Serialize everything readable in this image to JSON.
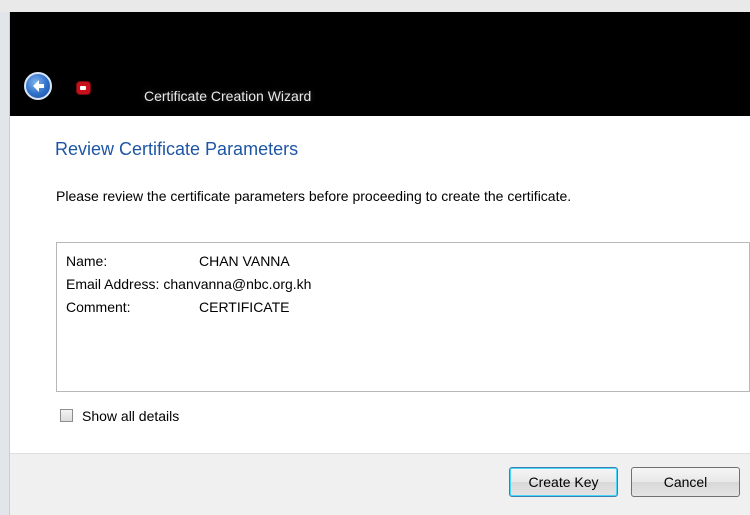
{
  "window": {
    "title": "Certificate Creation Wizard",
    "back_icon": "back-arrow-icon",
    "app_icon": "certificate-app-icon"
  },
  "page": {
    "heading": "Review Certificate Parameters",
    "instructions": "Please review the certificate parameters before proceeding to create the certificate."
  },
  "parameters": [
    {
      "label": "Name:",
      "value": "CHAN VANNA"
    },
    {
      "label": "Email Address:",
      "value": "chanvanna@nbc.org.kh"
    },
    {
      "label": "Comment:",
      "value": "CERTIFICATE"
    }
  ],
  "show_details": {
    "label": "Show all details",
    "checked": false
  },
  "buttons": {
    "create": "Create Key",
    "cancel": "Cancel"
  },
  "colors": {
    "heading": "#1e56a5",
    "titlebar": "#000000",
    "content_bg": "#ffffff",
    "footer_bg": "#f0f0f0"
  }
}
